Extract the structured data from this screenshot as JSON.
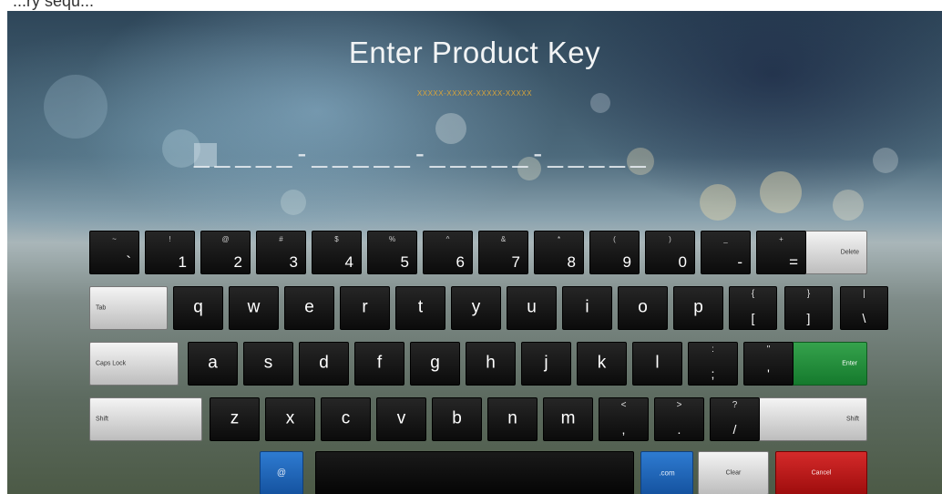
{
  "top_caption": "...ry                    sequ...",
  "title": "Enter Product Key",
  "hint_format": "XXXXX-XXXXX-XXXXX-XXXXX",
  "key_entry": "_____-_____-_____-_____",
  "keyboard": {
    "row1": [
      {
        "main": "`",
        "sub": "~"
      },
      {
        "main": "1",
        "sub": "!"
      },
      {
        "main": "2",
        "sub": "@"
      },
      {
        "main": "3",
        "sub": "#"
      },
      {
        "main": "4",
        "sub": "$"
      },
      {
        "main": "5",
        "sub": "%"
      },
      {
        "main": "6",
        "sub": "^"
      },
      {
        "main": "7",
        "sub": "&"
      },
      {
        "main": "8",
        "sub": "*"
      },
      {
        "main": "9",
        "sub": "("
      },
      {
        "main": "0",
        "sub": ")"
      },
      {
        "main": "-",
        "sub": "_"
      },
      {
        "main": "=",
        "sub": "+"
      }
    ],
    "delete": "Delete",
    "tab": "Tab",
    "row2": [
      "q",
      "w",
      "e",
      "r",
      "t",
      "y",
      "u",
      "i",
      "o",
      "p"
    ],
    "row2_sym": [
      {
        "main": "[",
        "sub": "{"
      },
      {
        "main": "]",
        "sub": "}"
      },
      {
        "main": "\\",
        "sub": "|"
      }
    ],
    "caps_lock": "Caps Lock",
    "row3": [
      "a",
      "s",
      "d",
      "f",
      "g",
      "h",
      "j",
      "k",
      "l"
    ],
    "row3_sym": [
      {
        "main": ";",
        "sub": ":"
      },
      {
        "main": "'",
        "sub": "\""
      }
    ],
    "enter": "Enter",
    "shift_left": "Shift",
    "row4": [
      "z",
      "x",
      "c",
      "v",
      "b",
      "n",
      "m"
    ],
    "row4_sym": [
      {
        "main": ",",
        "sub": "<"
      },
      {
        "main": ".",
        "sub": ">"
      },
      {
        "main": "/",
        "sub": "?"
      }
    ],
    "shift_right": "Shift",
    "at": "@",
    "dotcom": ".com",
    "clear": "Clear",
    "cancel": "Cancel"
  }
}
